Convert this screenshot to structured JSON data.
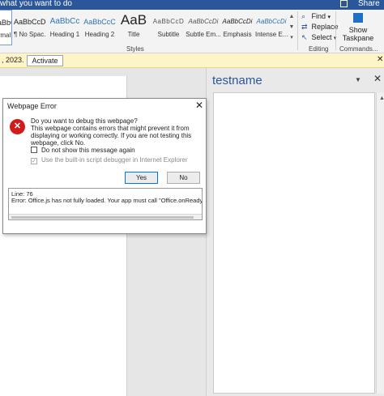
{
  "titlebar": {
    "tell_me": "what you want to do",
    "share_label": "Share"
  },
  "styles_gallery": {
    "items": [
      {
        "sample": "aBbCcDc",
        "name": "rmal"
      },
      {
        "sample": "AaBbCcDc",
        "name": "¶ No Spac..."
      },
      {
        "sample": "AaBbCc",
        "name": "Heading 1"
      },
      {
        "sample": "AaBbCcC",
        "name": "Heading 2"
      },
      {
        "sample": "AaB",
        "name": "Title"
      },
      {
        "sample": "AaBbCcD",
        "name": "Subtitle"
      },
      {
        "sample": "AaBbCcDi",
        "name": "Subtle Em..."
      },
      {
        "sample": "AaBbCcDi",
        "name": "Emphasis"
      },
      {
        "sample": "AaBbCcDi",
        "name": "Intense E..."
      }
    ],
    "group_label": "Styles"
  },
  "editing": {
    "find": "Find",
    "replace": "Replace",
    "select": "Select",
    "group_label": "Editing"
  },
  "commands": {
    "show_taskpane": "Show Taskpane",
    "group_label": "Commands..."
  },
  "notification": {
    "text": ", 2023.",
    "activate_label": "Activate"
  },
  "taskpane": {
    "title": "testname"
  },
  "dialog": {
    "title": "Webpage Error",
    "question": "Do you want to debug this webpage?",
    "message": "This webpage contains errors that might prevent it from displaying or working correctly. If you are not testing this webpage, click No.",
    "checkbox_dont_show": "Do not show this message again",
    "checkbox_debugger": "Use the built-in script debugger in Internet Explorer",
    "yes_label": "Yes",
    "no_label": "No",
    "details_line1": "Line: 76",
    "details_line2": "Error: Office.js has not fully loaded. Your app must call \"Office.onReady()\" as p"
  },
  "colors": {
    "accent": "#2b579a",
    "notification_bg": "#fdf5c7",
    "error_red": "#d11b1b"
  }
}
